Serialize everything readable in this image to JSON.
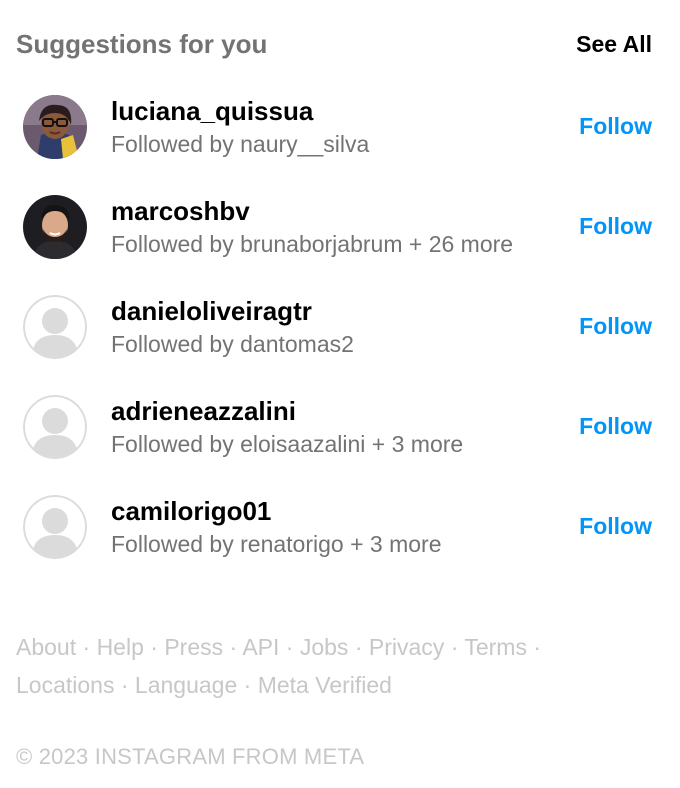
{
  "header": {
    "title": "Suggestions for you",
    "see_all": "See All"
  },
  "suggestions": [
    {
      "username": "luciana_quissua",
      "followed_by": "Followed by naury__silva",
      "follow_label": "Follow",
      "avatar": "photo-woman-glasses"
    },
    {
      "username": "marcoshbv",
      "followed_by": "Followed by brunaborjabrum + 26 more",
      "follow_label": "Follow",
      "avatar": "photo-man-beard"
    },
    {
      "username": "danieloliveiragtr",
      "followed_by": "Followed by dantomas2",
      "follow_label": "Follow",
      "avatar": "default-avatar-icon"
    },
    {
      "username": "adrieneazzalini",
      "followed_by": "Followed by eloisaazalini + 3 more",
      "follow_label": "Follow",
      "avatar": "default-avatar-icon"
    },
    {
      "username": "camilorigo01",
      "followed_by": "Followed by renatorigo + 3 more",
      "follow_label": "Follow",
      "avatar": "default-avatar-icon"
    }
  ],
  "footer": {
    "links": [
      "About",
      "Help",
      "Press",
      "API",
      "Jobs",
      "Privacy",
      "Terms",
      "Locations",
      "Language",
      "Meta Verified"
    ],
    "separator": "·",
    "copyright": "© 2023 INSTAGRAM FROM META"
  },
  "colors": {
    "follow": "#0095f6",
    "secondary_text": "#737373",
    "footer_text": "#c7c7c7"
  }
}
